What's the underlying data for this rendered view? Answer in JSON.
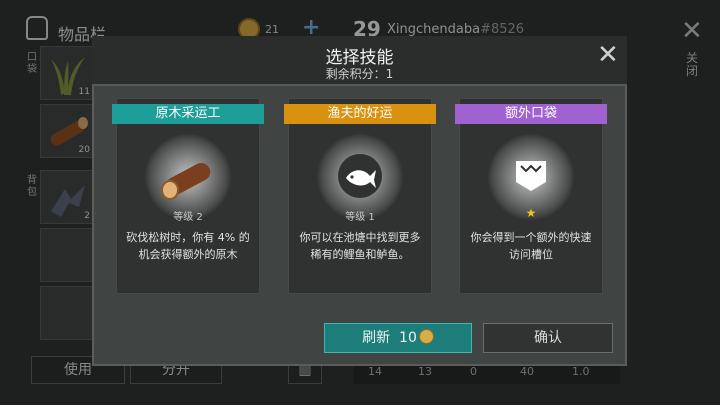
{
  "inventory": {
    "title": "物品栏",
    "coins": "21",
    "plus": "+",
    "level": "29",
    "username": "Xingchendaba",
    "user_tag": "#8526",
    "pocket_label": "口袋",
    "backpack_label": "背包",
    "slots": [
      {
        "icon": "grass-icon",
        "count": "11"
      },
      {
        "icon": "log-icon",
        "count": "20"
      },
      {
        "icon": "metal-scrap-icon",
        "count": "2"
      }
    ],
    "use_button": "使用",
    "split_button": "分开",
    "close_label": "关闭",
    "stats": [
      "14",
      "13",
      "0",
      "40",
      "1.0"
    ]
  },
  "modal": {
    "title": "选择技能",
    "subtitle": "剩余积分：1",
    "cards": [
      {
        "name": "原木采运工",
        "level": "等级 2",
        "desc": "砍伐松树时，你有 4% 的机会获得额外的原木",
        "icon": "log-icon",
        "color": "#1e9e99"
      },
      {
        "name": "渔夫的好运",
        "level": "等级 1",
        "desc": "你可以在池塘中找到更多稀有的鲤鱼和鲈鱼。",
        "icon": "fish-icon",
        "color": "#d9910f"
      },
      {
        "name": "额外口袋",
        "level": "★",
        "desc": "你会得到一个额外的快速访问槽位",
        "icon": "pocket-icon",
        "color": "#a062d0"
      }
    ],
    "refresh_label": "刷新",
    "refresh_cost": "10",
    "confirm_label": "确认"
  }
}
